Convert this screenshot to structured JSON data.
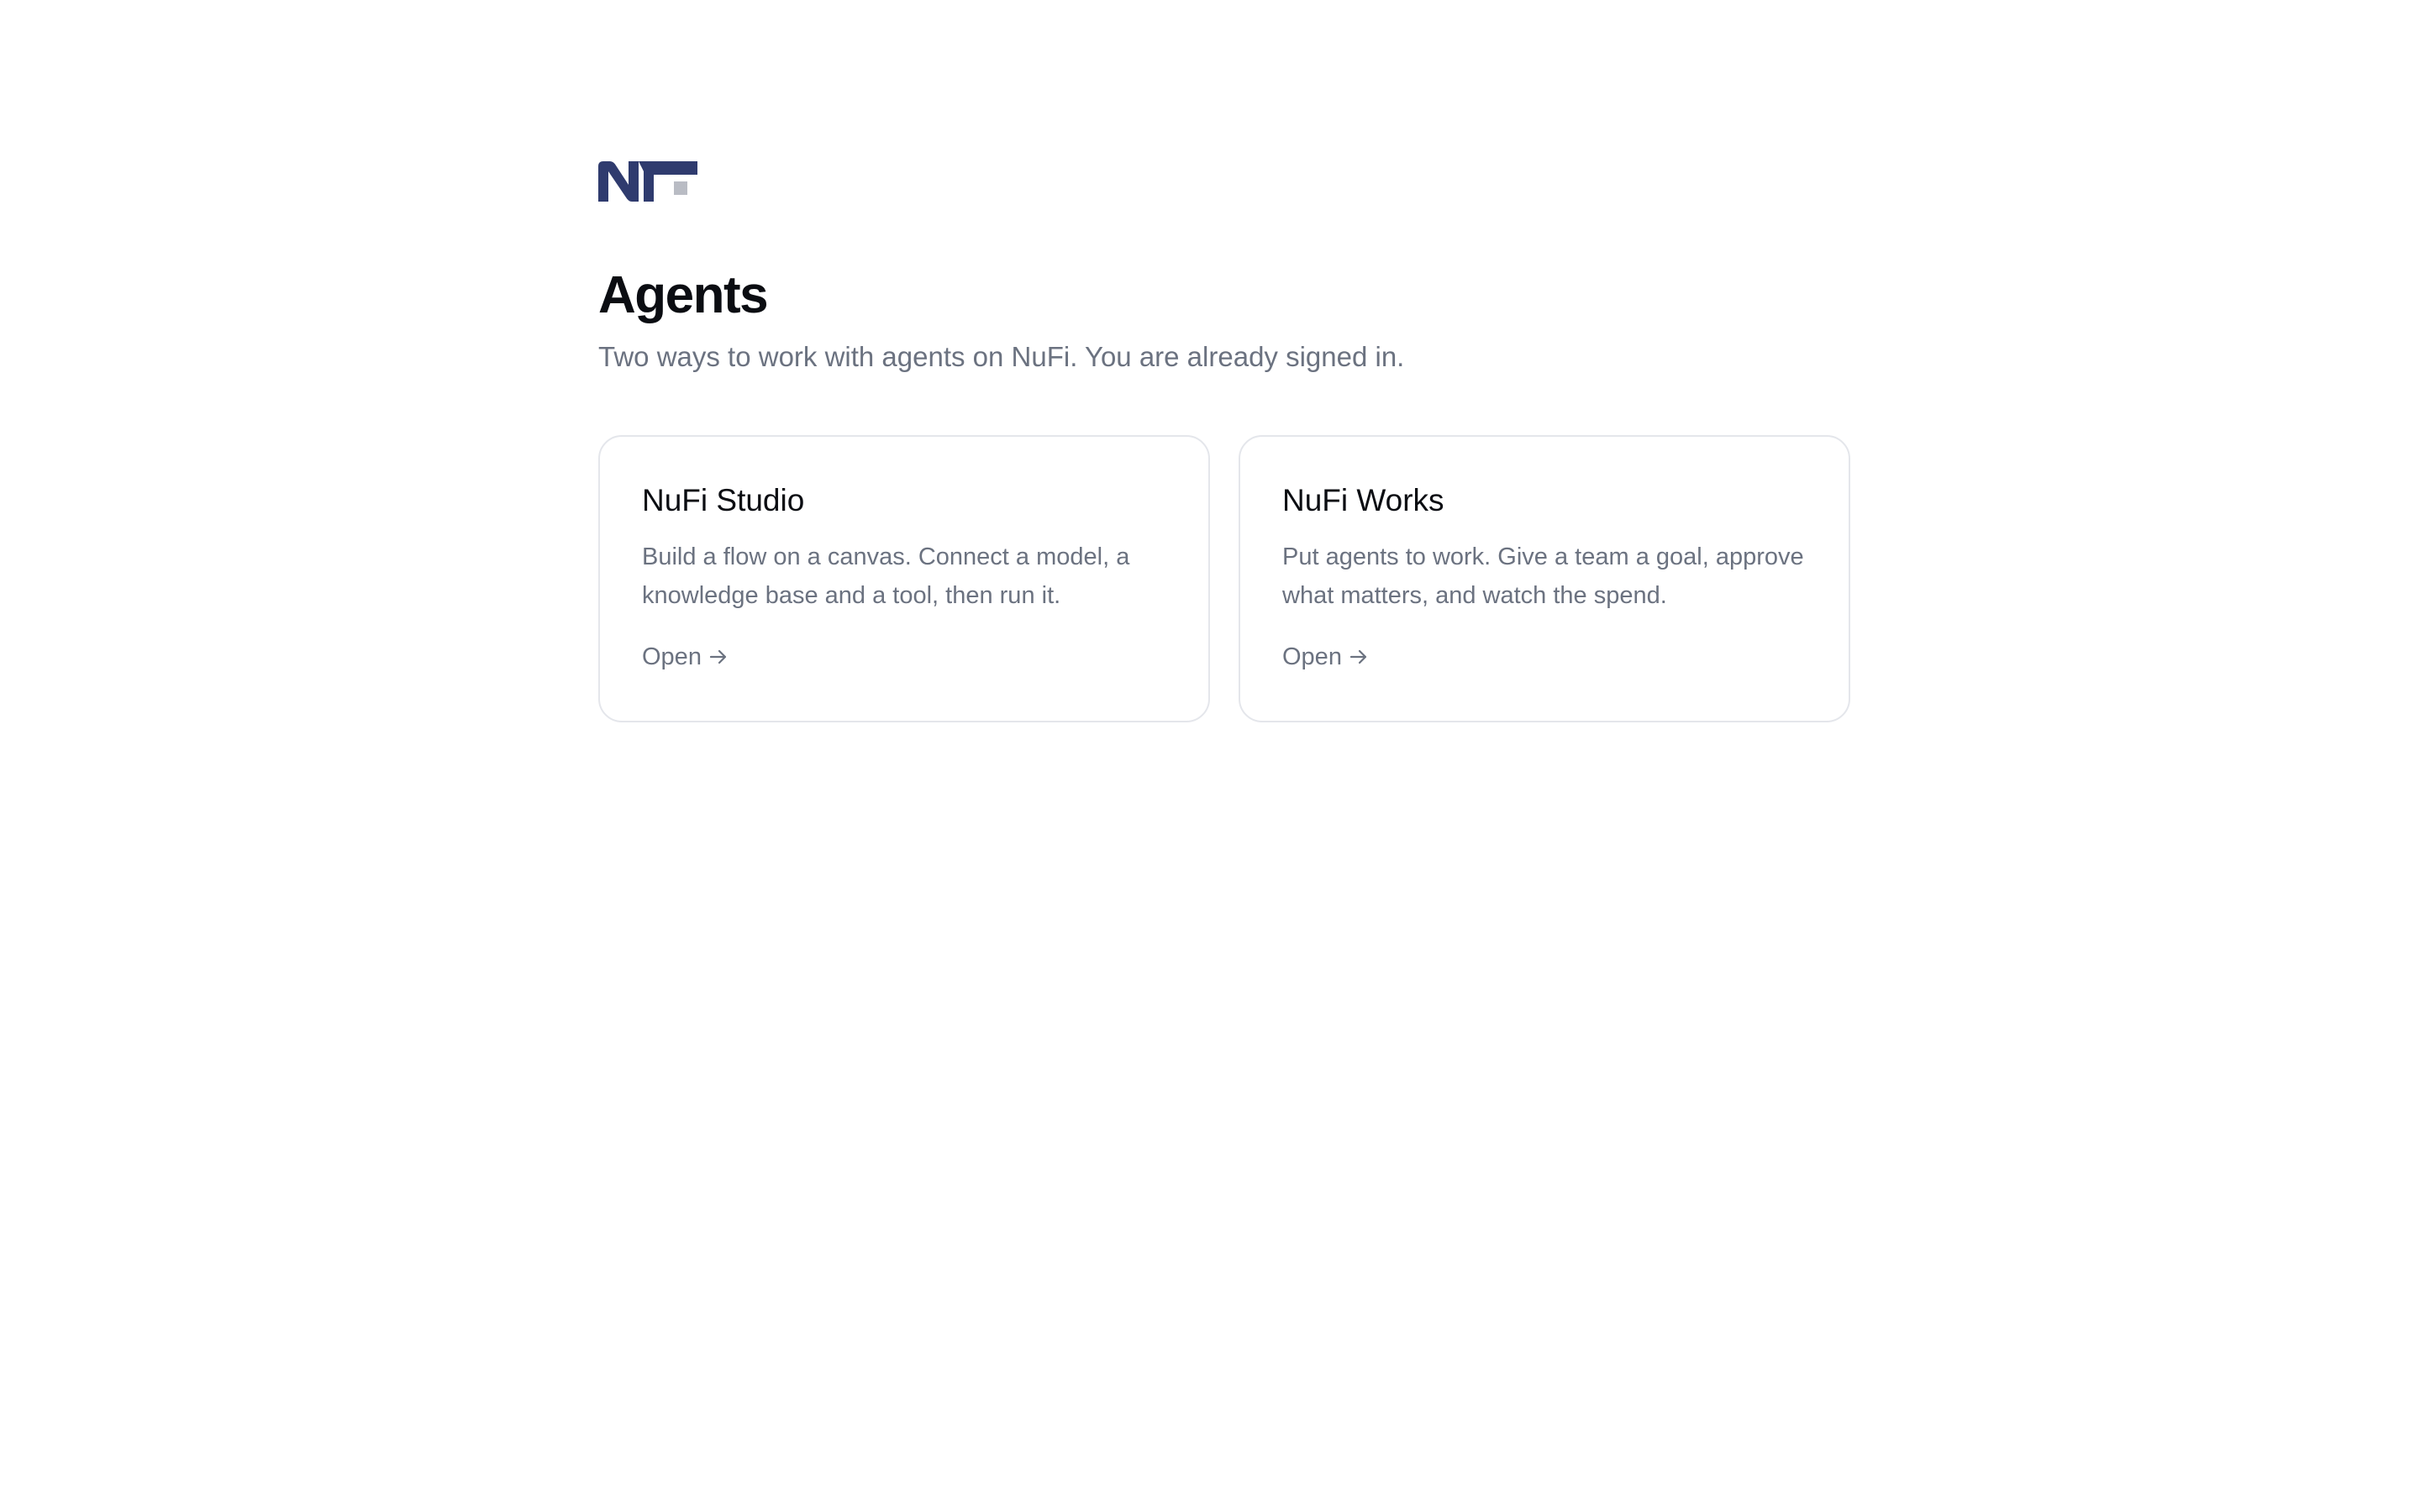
{
  "header": {
    "logo_icon": "nufi-logo-icon",
    "title": "Agents",
    "subtitle": "Two ways to work with agents on NuFi. You are already signed in."
  },
  "cards": [
    {
      "title": "NuFi Studio",
      "description": "Build a flow on a canvas. Connect a model, a knowledge base and a tool, then run it.",
      "link_label": "Open",
      "link_icon": "arrow-right-icon"
    },
    {
      "title": "NuFi Works",
      "description": "Put agents to work. Give a team a goal, approve what matters, and watch the spend.",
      "link_label": "Open",
      "link_icon": "arrow-right-icon"
    }
  ],
  "colors": {
    "logo_primary": "#2f3b6e",
    "logo_accent": "#b9bcc4",
    "text_primary": "#0b0d12",
    "text_muted": "#6b7280",
    "card_border": "#e4e6eb",
    "background": "#ffffff"
  }
}
